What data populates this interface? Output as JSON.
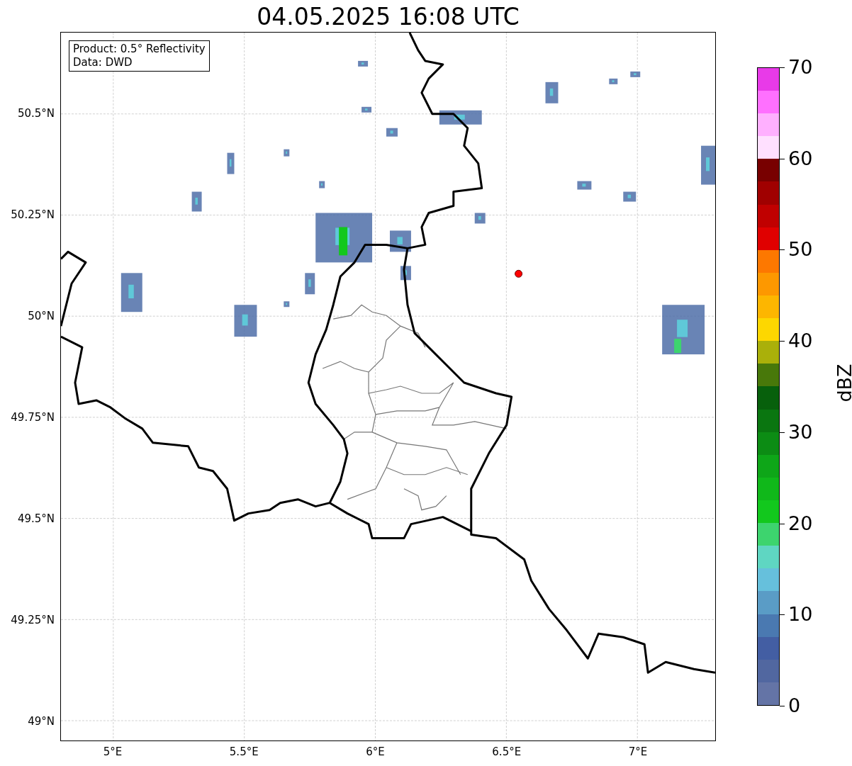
{
  "title": "04.05.2025 16:08 UTC",
  "legend": {
    "lines": [
      "Product: 0.5° Reflectivity",
      "Data: DWD"
    ]
  },
  "map": {
    "lat_labels": [
      "50.5°N",
      "50.25°N",
      "50°N",
      "49.75°N",
      "49.5°N",
      "49.25°N",
      "49°N"
    ],
    "lon_labels": [
      "5°E",
      "5.5°E",
      "6°E",
      "6.5°E",
      "7°E"
    ]
  },
  "colorbar": {
    "label": "dBZ",
    "ticks": [
      "70",
      "60",
      "50",
      "40",
      "30",
      "20",
      "10",
      "0"
    ],
    "bins": [
      {
        "color": "#6474a6"
      },
      {
        "color": "#5167a0"
      },
      {
        "color": "#435ea3"
      },
      {
        "color": "#4a79b1"
      },
      {
        "color": "#5a9cc6"
      },
      {
        "color": "#66c0dc"
      },
      {
        "color": "#5fd6c2"
      },
      {
        "color": "#3dd46e"
      },
      {
        "color": "#12c81d"
      },
      {
        "color": "#10b81a"
      },
      {
        "color": "#0ea618"
      },
      {
        "color": "#0c8c14"
      },
      {
        "color": "#0a7610"
      },
      {
        "color": "#07600c"
      },
      {
        "color": "#48780a"
      },
      {
        "color": "#aab00a"
      },
      {
        "color": "#fdd700"
      },
      {
        "color": "#fdb600"
      },
      {
        "color": "#fd9800"
      },
      {
        "color": "#fd7800"
      },
      {
        "color": "#e00000"
      },
      {
        "color": "#c00000"
      },
      {
        "color": "#a00000"
      },
      {
        "color": "#780000"
      },
      {
        "color": "#ffe0ff"
      },
      {
        "color": "#ffb0ff"
      },
      {
        "color": "#ff70ff"
      },
      {
        "color": "#e83ae8"
      }
    ]
  }
}
